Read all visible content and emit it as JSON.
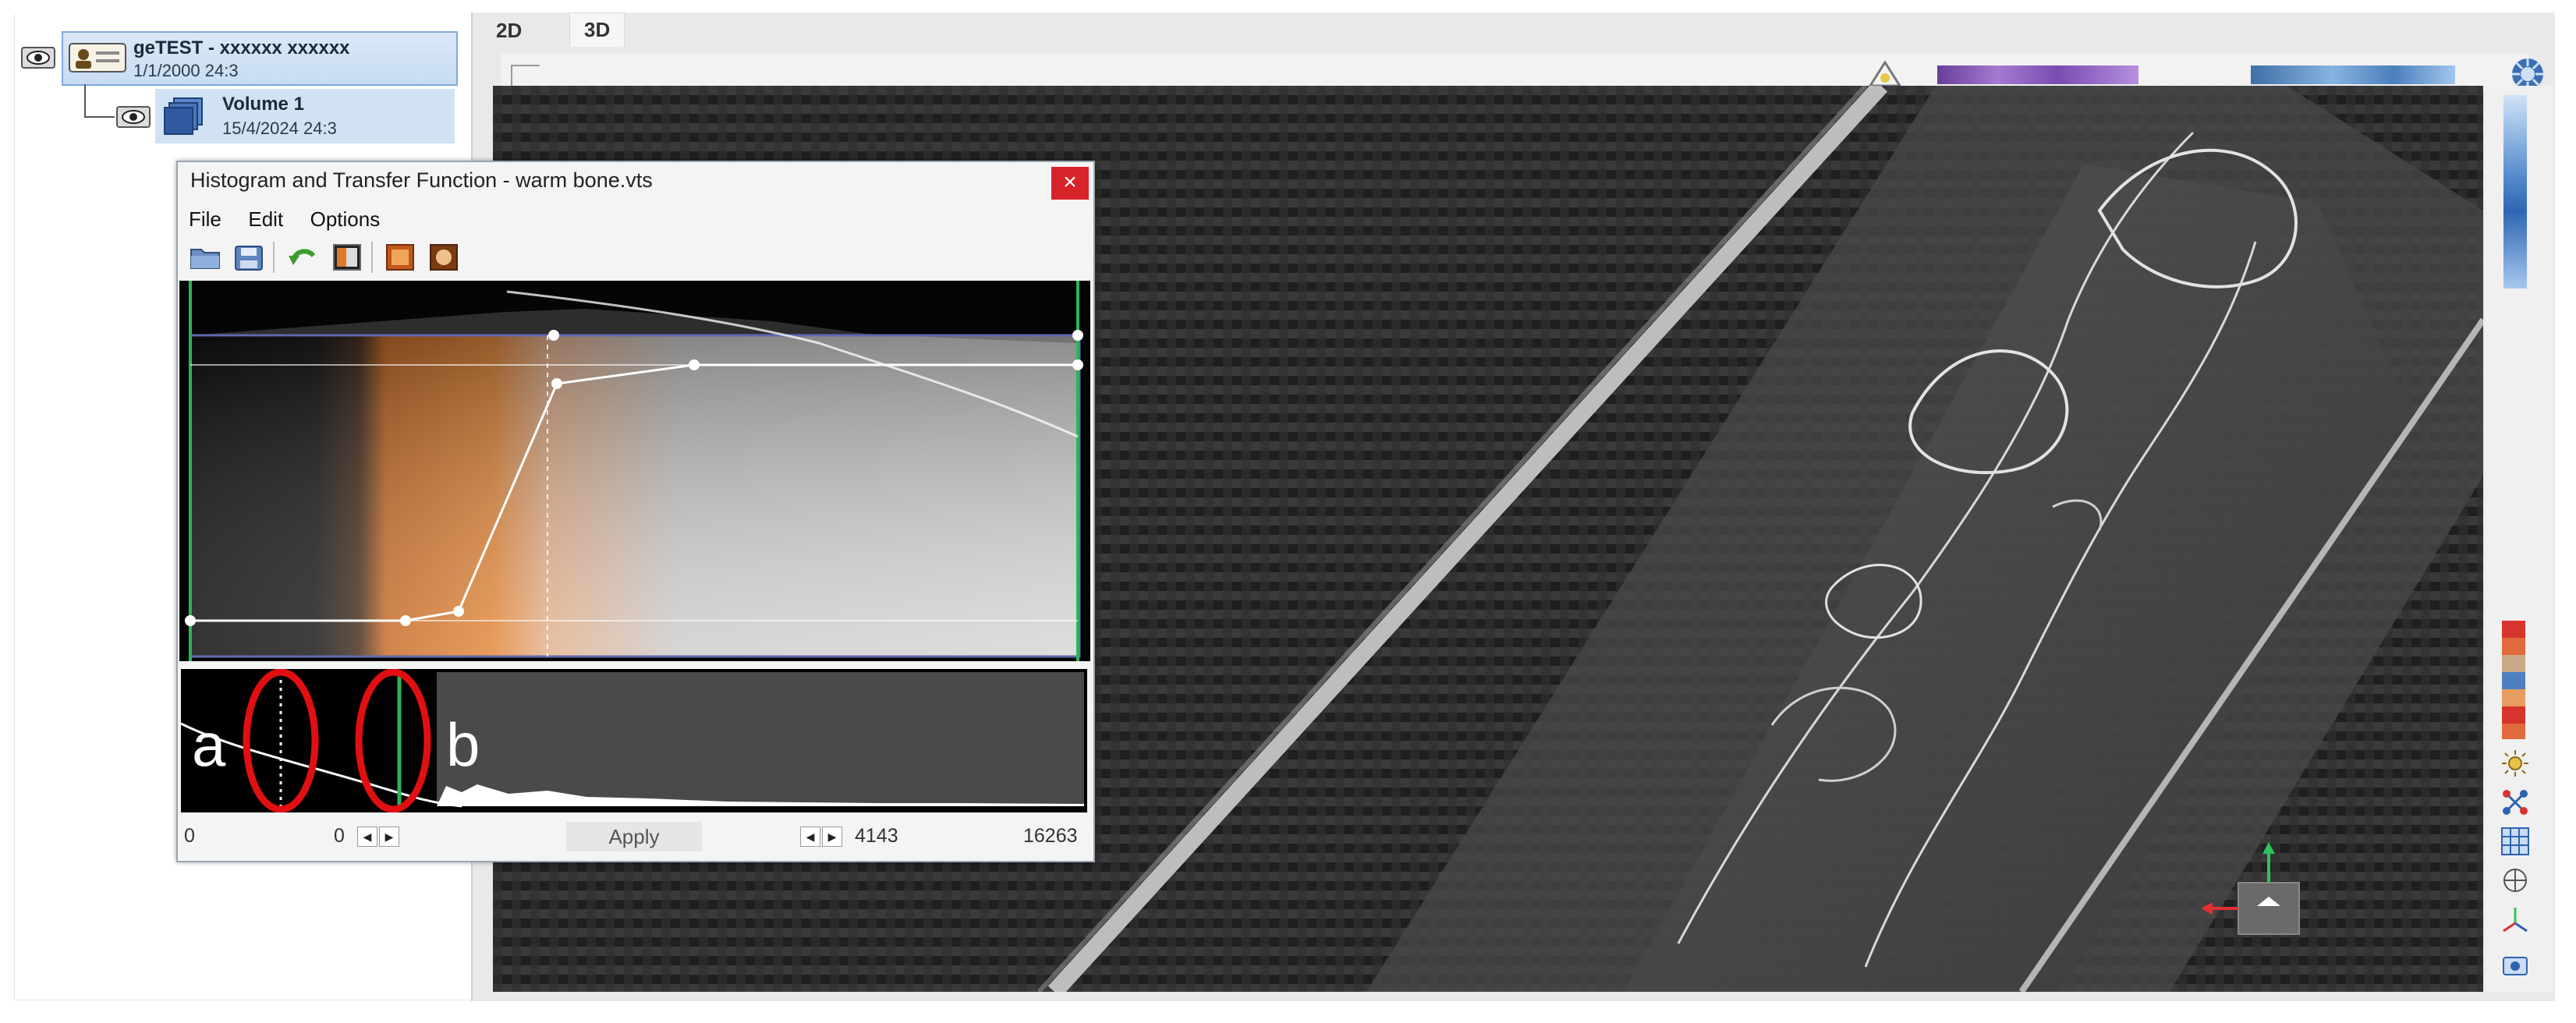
{
  "tree": {
    "patient": {
      "title": "geTEST - xxxxxx xxxxxx",
      "date": "1/1/2000  24:3"
    },
    "volume": {
      "title": "Volume 1",
      "date": "15/4/2024  24:3"
    }
  },
  "viewer": {
    "tabs": [
      "2D",
      "3D"
    ],
    "active_tab": "3D"
  },
  "dialog": {
    "title": "Histogram and Transfer Function - warm bone.vts",
    "close_label": "×",
    "menu": [
      "File",
      "Edit",
      "Options"
    ],
    "footer": {
      "min": "0",
      "lower_value": "0",
      "apply_label": "Apply",
      "upper_value": "4143",
      "max": "16263"
    }
  },
  "annotations": {
    "a": "a",
    "b": "b"
  },
  "icons": {
    "tree_eye": "eye-icon",
    "patient": "patient-icon",
    "volume": "volume-icon",
    "open": "folder-open-icon",
    "save": "save-icon",
    "undo": "undo-arrow-icon",
    "view_tf": "transfer-function-icon",
    "preset1": "preset-warm-icon",
    "preset2": "preset-bone-icon",
    "compass": "navigation-compass-icon",
    "orientation": "orientation-cube-icon"
  },
  "colors": {
    "accent_red": "#d8232a",
    "tree_selection": "#c8dcf3",
    "warm_orange": "#e07a2a",
    "annotation_red": "#e10f12"
  }
}
